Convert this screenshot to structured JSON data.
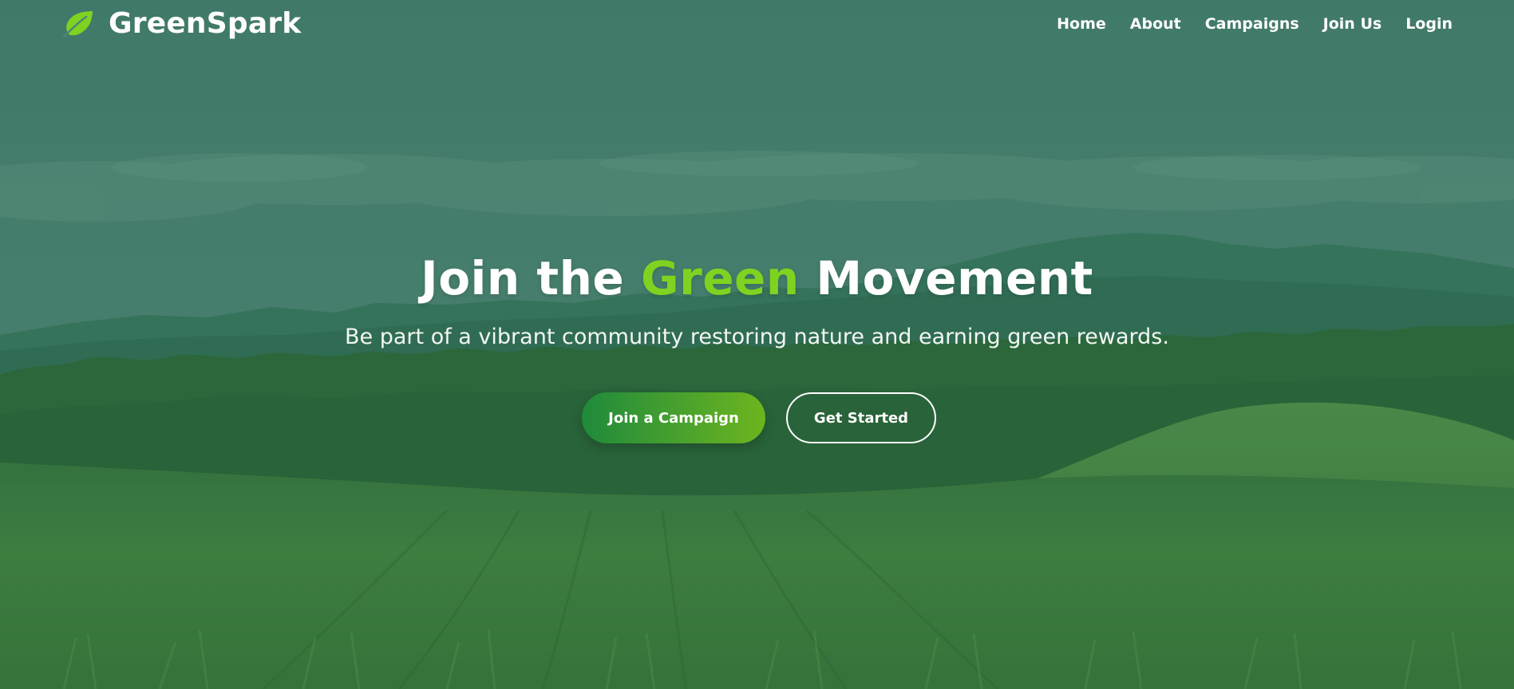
{
  "brand": {
    "name": "GreenSpark",
    "icon": "leaf-icon",
    "icon_color": "#7ed321"
  },
  "nav": {
    "items": [
      {
        "label": "Home"
      },
      {
        "label": "About"
      },
      {
        "label": "Campaigns"
      },
      {
        "label": "Join Us"
      },
      {
        "label": "Login"
      }
    ]
  },
  "hero": {
    "title_prefix": "Join the",
    "title_accent": "Green",
    "title_suffix": "Movement",
    "subtitle": "Be part of a vibrant community restoring nature and earning green rewards.",
    "primary_cta": "Join a Campaign",
    "secondary_cta": "Get Started"
  },
  "colors": {
    "accent": "#7ed321",
    "primary_button_start": "#1f8a3b",
    "primary_button_end": "#6db51e",
    "text": "#ffffff"
  }
}
